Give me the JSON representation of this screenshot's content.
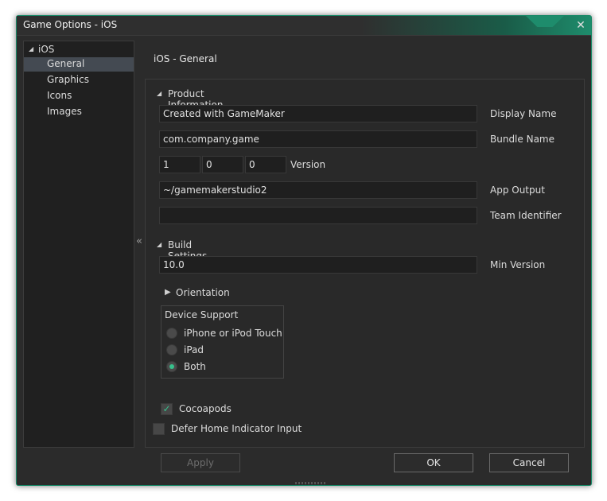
{
  "window": {
    "title": "Game Options - iOS",
    "close_icon": "close-icon",
    "accent_color": "#1e8c6c"
  },
  "tree": {
    "root": "iOS",
    "items": [
      {
        "label": "General",
        "selected": true
      },
      {
        "label": "Graphics",
        "selected": false
      },
      {
        "label": "Icons",
        "selected": false
      },
      {
        "label": "Images",
        "selected": false
      }
    ]
  },
  "collapse_glyph": "«",
  "page_heading": "iOS - General",
  "product_info": {
    "header": "Product Information",
    "display_name": {
      "value": "Created with GameMaker",
      "label": "Display Name"
    },
    "bundle_name": {
      "value": "com.company.game",
      "label": "Bundle Name"
    },
    "version": {
      "major": "1",
      "minor": "0",
      "patch": "0",
      "label": "Version"
    },
    "app_output": {
      "value": "~/gamemakerstudio2",
      "label": "App Output"
    },
    "team_identifier": {
      "value": "",
      "label": "Team Identifier"
    }
  },
  "build_settings": {
    "header": "Build Settings",
    "min_version": {
      "value": "10.0",
      "label": "Min Version"
    },
    "orientation": "Orientation",
    "device_support": {
      "title": "Device Support",
      "options": [
        "iPhone or iPod Touch",
        "iPad",
        "Both"
      ],
      "selected": "Both"
    },
    "cocoapods": {
      "label": "Cocoapods",
      "checked": true
    },
    "defer_home": {
      "label": "Defer Home Indicator Input",
      "checked": false
    }
  },
  "buttons": {
    "apply": "Apply",
    "ok": "OK",
    "cancel": "Cancel"
  }
}
